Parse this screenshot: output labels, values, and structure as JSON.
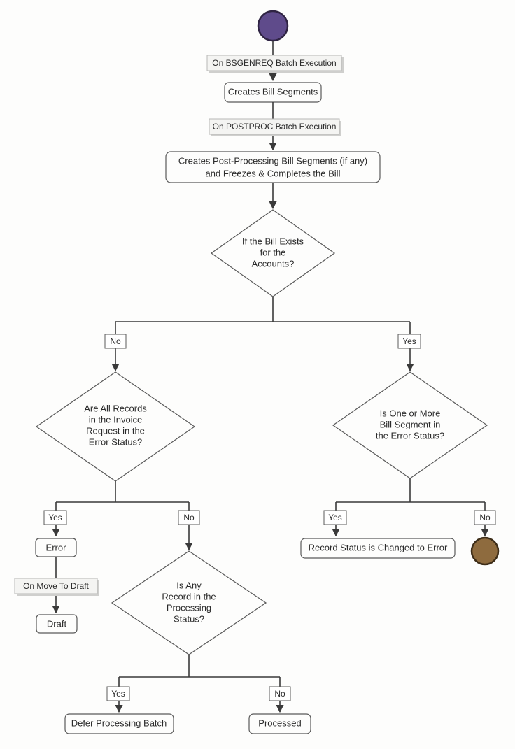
{
  "chart_data": {
    "type": "flowchart",
    "nodes": [
      {
        "id": "start",
        "kind": "start"
      },
      {
        "id": "lbl_bsgenreq",
        "kind": "edge_label",
        "text": "On BSGENREQ Batch Execution"
      },
      {
        "id": "p_create_bs",
        "kind": "process",
        "text": "Creates Bill Segments"
      },
      {
        "id": "lbl_postproc",
        "kind": "edge_label",
        "text": "On POSTPROC Batch Execution"
      },
      {
        "id": "p_postprocess",
        "kind": "process",
        "text_lines": [
          "Creates Post-Processing Bill Segments (if any)",
          "and Freezes & Completes the Bill"
        ]
      },
      {
        "id": "d_bill_exists",
        "kind": "decision",
        "text_lines": [
          "If the Bill Exists",
          "for the",
          "Accounts?"
        ]
      },
      {
        "id": "d_all_error",
        "kind": "decision",
        "text_lines": [
          "Are All Records",
          "in the Invoice",
          "Request in the",
          "Error Status?"
        ]
      },
      {
        "id": "d_one_or_more",
        "kind": "decision",
        "text_lines": [
          "Is One or More",
          "Bill Segment in",
          "the Error Status?"
        ]
      },
      {
        "id": "p_record_error",
        "kind": "process",
        "text": "Record Status is Changed to Error"
      },
      {
        "id": "end",
        "kind": "end"
      },
      {
        "id": "p_error",
        "kind": "process",
        "text": "Error"
      },
      {
        "id": "lbl_move_draft",
        "kind": "edge_label",
        "text": "On Move To Draft"
      },
      {
        "id": "p_draft",
        "kind": "process",
        "text": "Draft"
      },
      {
        "id": "d_any_processing",
        "kind": "decision",
        "text_lines": [
          "Is Any",
          "Record in the",
          "Processing",
          "Status?"
        ]
      },
      {
        "id": "p_defer",
        "kind": "process",
        "text": "Defer Processing Batch"
      },
      {
        "id": "p_processed",
        "kind": "process",
        "text": "Processed"
      }
    ],
    "branch_labels": {
      "no": "No",
      "yes": "Yes"
    },
    "edges": [
      {
        "from": "start",
        "to": "p_create_bs",
        "via": "lbl_bsgenreq"
      },
      {
        "from": "p_create_bs",
        "to": "p_postprocess",
        "via": "lbl_postproc"
      },
      {
        "from": "p_postprocess",
        "to": "d_bill_exists"
      },
      {
        "from": "d_bill_exists",
        "to": "d_all_error",
        "branch": "No"
      },
      {
        "from": "d_bill_exists",
        "to": "d_one_or_more",
        "branch": "Yes"
      },
      {
        "from": "d_one_or_more",
        "to": "p_record_error",
        "branch": "Yes"
      },
      {
        "from": "d_one_or_more",
        "to": "end",
        "branch": "No"
      },
      {
        "from": "d_all_error",
        "to": "p_error",
        "branch": "Yes"
      },
      {
        "from": "p_error",
        "to": "p_draft",
        "via": "lbl_move_draft"
      },
      {
        "from": "d_all_error",
        "to": "d_any_processing",
        "branch": "No"
      },
      {
        "from": "d_any_processing",
        "to": "p_defer",
        "branch": "Yes"
      },
      {
        "from": "d_any_processing",
        "to": "p_processed",
        "branch": "No"
      }
    ]
  }
}
